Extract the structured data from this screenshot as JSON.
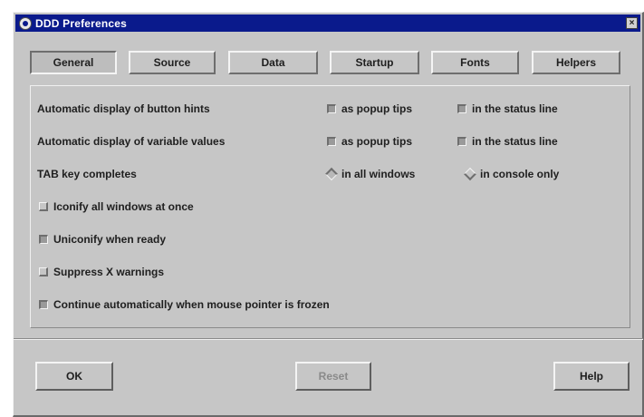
{
  "window": {
    "title": "DDD Preferences",
    "close_glyph": "×"
  },
  "tabs": [
    {
      "label": "General",
      "active": true
    },
    {
      "label": "Source",
      "active": false
    },
    {
      "label": "Data",
      "active": false
    },
    {
      "label": "Startup",
      "active": false
    },
    {
      "label": "Fonts",
      "active": false
    },
    {
      "label": "Helpers",
      "active": false
    }
  ],
  "general": {
    "button_hints": {
      "label": "Automatic display of button hints",
      "popup_label": "as popup tips",
      "popup_checked": true,
      "status_label": "in the status line",
      "status_checked": true
    },
    "variable_values": {
      "label": "Automatic display of variable values",
      "popup_label": "as popup tips",
      "popup_checked": true,
      "status_label": "in the status line",
      "status_checked": true
    },
    "tab_completes": {
      "label": "TAB key completes",
      "all_windows_label": "in all windows",
      "all_windows_selected": true,
      "console_only_label": "in console only",
      "console_only_selected": false
    },
    "iconify_all": {
      "label": "Iconify all windows at once",
      "checked": false
    },
    "uniconify_ready": {
      "label": "Uniconify when ready",
      "checked": true
    },
    "suppress_x": {
      "label": "Suppress X warnings",
      "checked": false
    },
    "continue_frozen": {
      "label": "Continue automatically when mouse pointer is frozen",
      "checked": true
    }
  },
  "buttons": {
    "ok": "OK",
    "reset": "Reset",
    "help": "Help"
  },
  "colors": {
    "titlebar": "#0a1a8c",
    "background": "#c6c6c6"
  }
}
